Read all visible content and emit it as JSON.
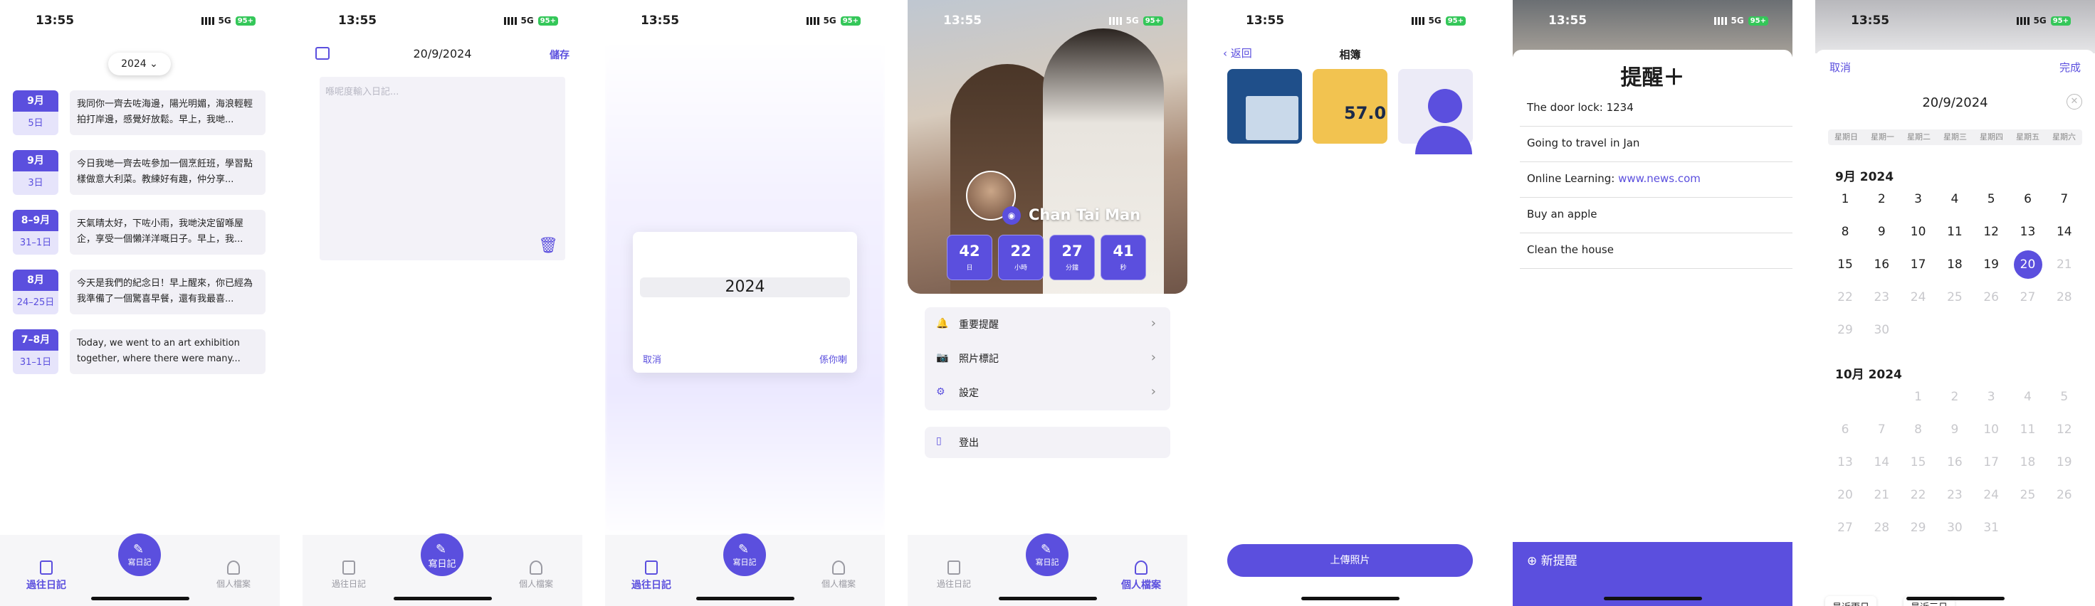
{
  "status": {
    "time": "13:55",
    "network": "5G",
    "battery": "95+"
  },
  "tabs": {
    "past": "過往日記",
    "write": "寫日記",
    "profile": "個人檔案"
  },
  "diary_list": {
    "year_selector": "2024",
    "entries": [
      {
        "month": "9月",
        "day": "5日",
        "text": "我同你一齊去咗海邊，陽光明媚，海浪輕輕拍打岸邊，感覺好放鬆。早上，我哋..."
      },
      {
        "month": "9月",
        "day": "3日",
        "text": "今日我哋一齊去咗參加一個烹飪班，學習點樣做意大利菜。教練好有趣，仲分享..."
      },
      {
        "month": "8–9月",
        "day": "31–1日",
        "text": "天氣晴太好，下咗小雨，我哋決定留喺屋企，享受一個懶洋洋嘅日子。早上，我..."
      },
      {
        "month": "8月",
        "day": "24–25日",
        "text": "今天是我們的紀念日！早上醒來，你已經為我準備了一個驚喜早餐，還有我最喜..."
      },
      {
        "month": "7–8月",
        "day": "31–1日",
        "text": "Today, we went to an art exhibition together, where there were many..."
      }
    ]
  },
  "write_diary": {
    "date": "20/9/2024",
    "save": "儲存",
    "placeholder": "喺呢度輸入日記..."
  },
  "year_picker": {
    "value": "2024",
    "cancel": "取消",
    "confirm": "係你喇"
  },
  "profile": {
    "name": "Chan Tai Man",
    "countdown": [
      {
        "value": "42",
        "unit": "日"
      },
      {
        "value": "22",
        "unit": "小時"
      },
      {
        "value": "27",
        "unit": "分鐘"
      },
      {
        "value": "41",
        "unit": "秒"
      }
    ],
    "menu": [
      "重要提醒",
      "照片標記",
      "設定"
    ],
    "logout": "登出"
  },
  "album": {
    "back": "返回",
    "title": "相簿",
    "upload": "上傳照片",
    "thumb2_text": "57.0"
  },
  "reminders": {
    "title": "提醒＋",
    "items": [
      "The door lock: 1234",
      "Going to travel in Jan",
      "Online Learning: ",
      "Buy an apple",
      "Clean the house"
    ],
    "link": "www.news.com",
    "new_button": "新提醒"
  },
  "calendar": {
    "cancel": "取消",
    "done": "完成",
    "date": "20/9/2024",
    "weekdays": [
      "星期日",
      "星期一",
      "星期二",
      "星期三",
      "星期四",
      "星期五",
      "星期六"
    ],
    "month1": "9月 2024",
    "month2": "10月 2024",
    "quick": [
      "最近兩日",
      "最近三日"
    ]
  },
  "colors": {
    "accent": "#5b4fde",
    "battery": "#34c759"
  }
}
